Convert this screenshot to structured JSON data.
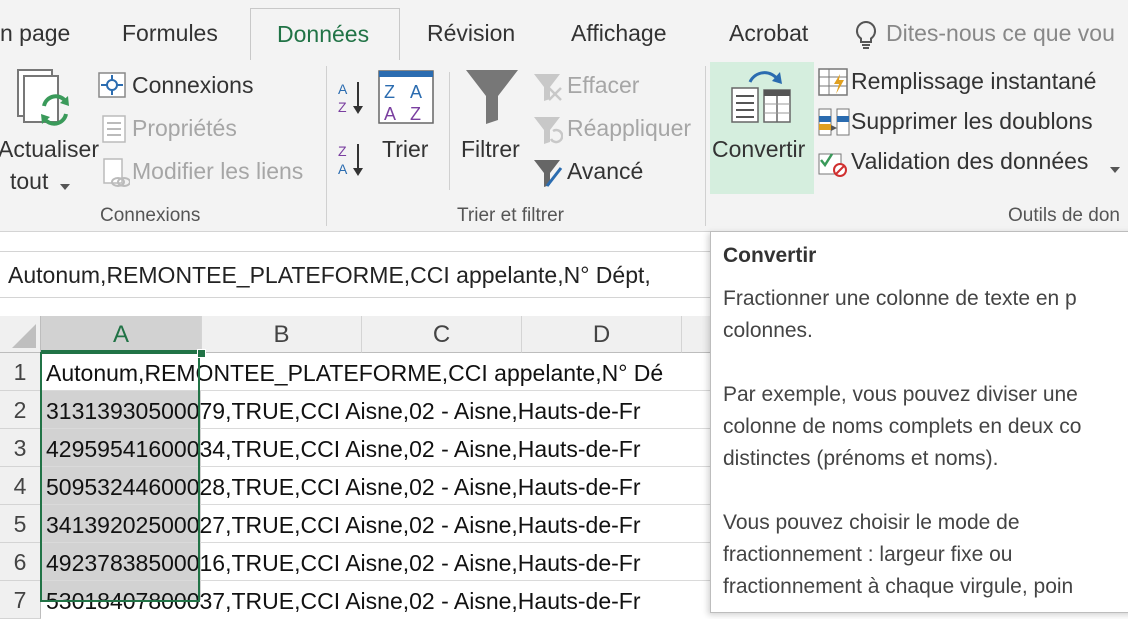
{
  "tabs": {
    "mise_en_page": "n page",
    "formules": "Formules",
    "donnees": "Données",
    "revision": "Révision",
    "affichage": "Affichage",
    "acrobat": "Acrobat",
    "tell_me": "Dites-nous ce que vou"
  },
  "ribbon": {
    "actualiser_line1": "Actualiser",
    "actualiser_line2": "tout",
    "connexions": "Connexions",
    "proprietes": "Propriétés",
    "modifier_liens": "Modifier les liens",
    "group_connexions": "Connexions",
    "trier": "Trier",
    "filtrer": "Filtrer",
    "effacer": "Effacer",
    "reappliquer": "Réappliquer",
    "avance": "Avancé",
    "group_trier_filtrer": "Trier et filtrer",
    "convertir": "Convertir",
    "remplissage": "Remplissage instantané",
    "supprimer_doublons": "Supprimer les doublons",
    "validation": "Validation des données",
    "group_outils": "Outils de don"
  },
  "formula_bar": {
    "content": "Autonum,REMONTEE_PLATEFORME,CCI appelante,N° Dépt,"
  },
  "grid": {
    "columns": [
      "A",
      "B",
      "C",
      "D"
    ],
    "rows": [
      {
        "num": "1",
        "text": "Autonum,REMONTEE_PLATEFORME,CCI appelante,N° Dé"
      },
      {
        "num": "2",
        "text": "31313930500079,TRUE,CCI Aisne,02 - Aisne,Hauts-de-Fr"
      },
      {
        "num": "3",
        "text": "42959541600034,TRUE,CCI Aisne,02 - Aisne,Hauts-de-Fr"
      },
      {
        "num": "4",
        "text": "50953244600028,TRUE,CCI Aisne,02 - Aisne,Hauts-de-Fr"
      },
      {
        "num": "5",
        "text": "34139202500027,TRUE,CCI Aisne,02 - Aisne,Hauts-de-Fr"
      },
      {
        "num": "6",
        "text": "49237838500016,TRUE,CCI Aisne,02 - Aisne,Hauts-de-Fr"
      },
      {
        "num": "7",
        "text": "53018407800037,TRUE,CCI Aisne,02 - Aisne,Hauts-de-Fr"
      }
    ]
  },
  "tooltip": {
    "title": "Convertir",
    "lines": [
      "Fractionner une colonne de texte en p",
      "colonnes.",
      "",
      "Par exemple, vous pouvez diviser une",
      "colonne de noms complets en deux co",
      "distinctes (prénoms et noms).",
      "",
      "Vous pouvez choisir le mode de",
      "fractionnement : largeur fixe ou",
      "fractionnement à chaque virgule, poin"
    ]
  },
  "colors": {
    "accent_green": "#217346",
    "selected_column_fill": "#d2d2d2",
    "convertir_highlight": "#d5eede"
  }
}
